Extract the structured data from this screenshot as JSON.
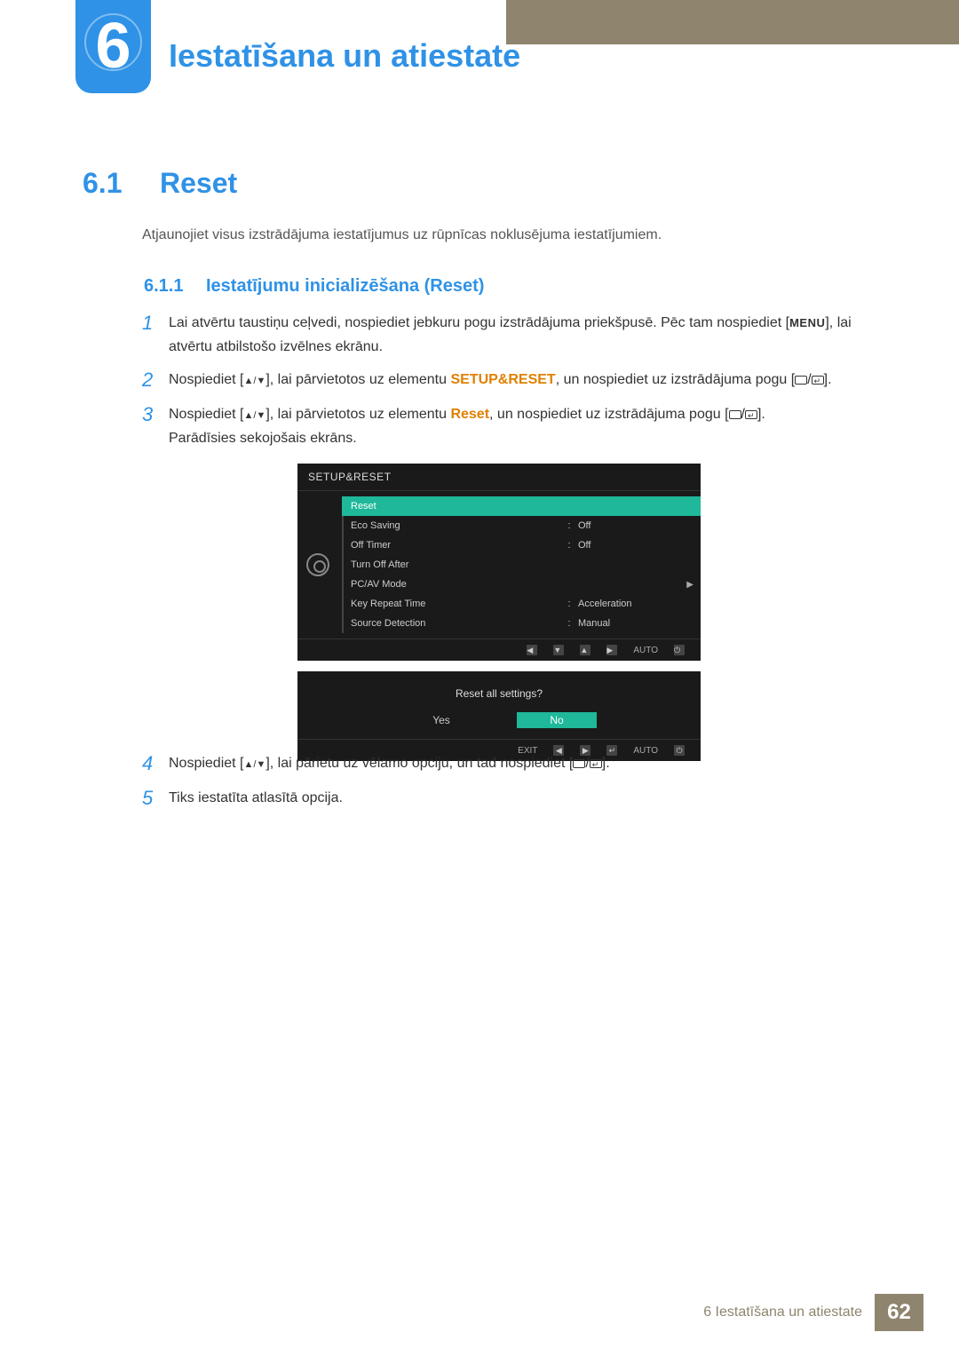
{
  "chapter": {
    "number": "6",
    "title": "Iestatīšana un atiestate"
  },
  "section": {
    "number": "6.1",
    "title": "Reset",
    "intro": "Atjaunojiet visus izstrādājuma iestatījumus uz rūpnīcas noklusējuma iestatījumiem."
  },
  "subsection": {
    "number": "6.1.1",
    "title": "Iestatījumu inicializēšana (Reset)"
  },
  "steps": {
    "s1": {
      "num": "1",
      "text_a": "Lai atvērtu taustiņu ceļvedi, nospiediet jebkuru pogu izstrādājuma priekšpusē. Pēc tam nospiediet [",
      "menu": "MENU",
      "text_b": "], lai atvērtu atbilstošo izvēlnes ekrānu."
    },
    "s2": {
      "num": "2",
      "text_a": "Nospiediet [",
      "arrows": "▲/▼",
      "text_b": "], lai pārvietotos uz elementu ",
      "kw": "SETUP&RESET",
      "text_c": ", un nospiediet uz izstrādājuma pogu ["
    },
    "s3": {
      "num": "3",
      "text_a": "Nospiediet [",
      "arrows": "▲/▼",
      "text_b": "], lai pārvietotos uz elementu ",
      "kw": "Reset",
      "text_c": ", un nospiediet uz izstrādājuma pogu [",
      "text_d": "Parādīsies sekojošais ekrāns."
    },
    "s4": {
      "num": "4",
      "text_a": "Nospiediet [",
      "arrows": "▲/▼",
      "text_b": "], lai pārietu uz vēlamo opciju, un tad nospiediet ["
    },
    "s5": {
      "num": "5",
      "text": "Tiks iestatīta atlasītā opcija."
    }
  },
  "osd1": {
    "header": "SETUP&RESET",
    "rows": [
      {
        "label": "Reset",
        "value": "",
        "selected": true
      },
      {
        "label": "Eco Saving",
        "colon": ":",
        "value": "Off"
      },
      {
        "label": "Off Timer",
        "colon": ":",
        "value": "Off"
      },
      {
        "label": "Turn Off After",
        "value": ""
      },
      {
        "label": "PC/AV Mode",
        "value": "",
        "arrow": true
      },
      {
        "label": "Key Repeat Time",
        "colon": ":",
        "value": "Acceleration"
      },
      {
        "label": "Source Detection",
        "colon": ":",
        "value": "Manual"
      }
    ],
    "footer": {
      "auto": "AUTO"
    }
  },
  "osd2": {
    "question": "Reset all settings?",
    "yes": "Yes",
    "no": "No",
    "footer": {
      "exit": "EXIT",
      "auto": "AUTO"
    }
  },
  "footer": {
    "text": "6 Iestatīšana un atiestate",
    "page": "62"
  }
}
